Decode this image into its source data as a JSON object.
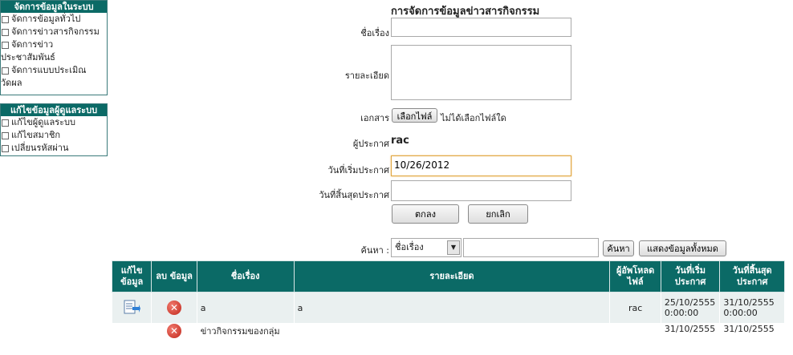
{
  "sidebar": {
    "system_panel": {
      "title": "จัดการข้อมูลในระบบ",
      "items": [
        "จัดการข้อมูลทั่วไป",
        "จัดการข่าวสารกิจกรรม",
        "จัดการข่าวประชาสัมพันธ์",
        "จัดการแบบประเมิณ",
        "วัดผล"
      ]
    },
    "user_panel": {
      "title": "แก้ไขข้อมูลผู้ดูแลระบบ",
      "items": [
        "แก้ไขผู้ดูแลระบบ",
        "แก้ไขสมาชิก",
        "เปลี่ยนรหัสผ่าน"
      ]
    }
  },
  "form": {
    "title": "การจัดการข้อมูลข่าวสารกิจกรรม",
    "subject_label": "ชื่อเรื่อง",
    "subject_value": "",
    "detail_label": "รายละเอียด",
    "attach_label": "เอกสาร",
    "file_button": "เลือกไฟล์",
    "file_status": "ไม่ได้เลือกไฟล์ใด",
    "author_label": "ผู้ประกาศ",
    "author_value": "rac",
    "start_label": "วันที่เริ่มประกาศ",
    "start_value": "10/26/2012",
    "end_label": "วันที่สิ้นสุดประกาศ",
    "end_value": "",
    "ok_button": "ตกลง",
    "cancel_button": "ยกเลิก"
  },
  "search": {
    "label": "ค้นหา :",
    "field_selected": "ชื่อเรื่อง",
    "query": "",
    "search_button": "ค้นหา",
    "show_all_button": "แสดงข้อมูลทั้งหมด"
  },
  "table": {
    "headers": [
      "แก้ไข ข้อมูล",
      "ลบ ข้อมูล",
      "ชื่อเรื่อง",
      "รายละเอียด",
      "ผู้อัพโหลด ไฟล์",
      "วันที่เริ่ม ประกาศ",
      "วันที่สิ้นสุด ประกาศ"
    ],
    "rows": [
      {
        "title": "a",
        "detail": "a",
        "uploader": "rac",
        "start": "25/10/2555 0:00:00",
        "end": "31/10/2555 0:00:00"
      },
      {
        "title": "ข่าวกิจกรรมของกลุ่ม",
        "detail": "",
        "uploader": "",
        "start": "31/10/2555",
        "end": "31/10/2555"
      }
    ]
  },
  "colors": {
    "header_teal": "#0b6a66",
    "focus_border": "#e0a640",
    "delete_red": "#c0271b"
  }
}
